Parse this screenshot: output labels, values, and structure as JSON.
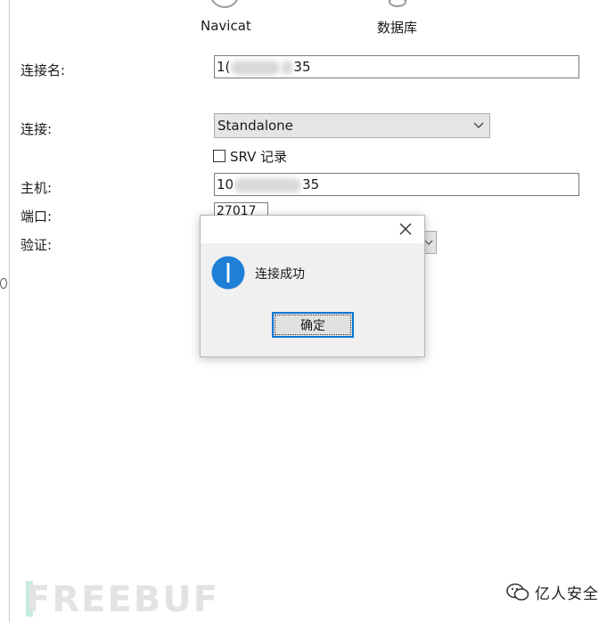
{
  "top_icons": [
    {
      "label": "Navicat",
      "icon": "navicat-connection-icon"
    },
    {
      "label": "数据库",
      "icon": "database-icon"
    }
  ],
  "form": {
    "connection_name": {
      "label": "连接名:",
      "value_prefix": "1(",
      "value_suffix": "35"
    },
    "connection": {
      "label": "连接:",
      "value": "Standalone",
      "icon": "chevron-down-icon"
    },
    "srv": {
      "label": "SRV 记录",
      "checked": false
    },
    "host": {
      "label": "主机:",
      "value_prefix": "10",
      "value_suffix": "35"
    },
    "port": {
      "label": "端口:",
      "value": "27017"
    },
    "auth": {
      "label": "验证:"
    }
  },
  "dialog": {
    "message": "连接成功",
    "ok_label": "确定",
    "icon": "info-icon",
    "close_icon": "close-icon",
    "accent": "#1e7fd6"
  },
  "watermarks": {
    "left_logo_text": "FREEBUF",
    "right_text": "亿人安全"
  }
}
